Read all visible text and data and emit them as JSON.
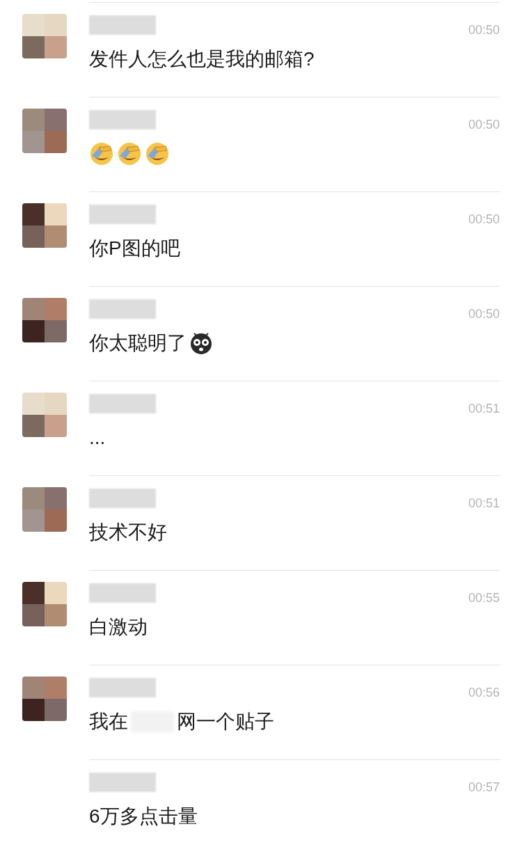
{
  "messages": [
    {
      "avatar": true,
      "time": "00:50",
      "parts": [
        {
          "kind": "text",
          "text": "发件人怎么也是我的邮箱?"
        }
      ]
    },
    {
      "avatar": true,
      "time": "00:50",
      "parts": [
        {
          "kind": "facepalm"
        },
        {
          "kind": "facepalm"
        },
        {
          "kind": "facepalm"
        }
      ]
    },
    {
      "avatar": true,
      "time": "00:50",
      "parts": [
        {
          "kind": "text",
          "text": "你P图的吧"
        }
      ]
    },
    {
      "avatar": true,
      "time": "00:50",
      "parts": [
        {
          "kind": "text",
          "text": "你太聪明了"
        },
        {
          "kind": "shocked"
        }
      ]
    },
    {
      "avatar": true,
      "time": "00:51",
      "parts": [
        {
          "kind": "text",
          "text": "..."
        }
      ]
    },
    {
      "avatar": true,
      "time": "00:51",
      "parts": [
        {
          "kind": "text",
          "text": "技术不好"
        }
      ]
    },
    {
      "avatar": true,
      "time": "00:55",
      "parts": [
        {
          "kind": "text",
          "text": "白激动"
        }
      ]
    },
    {
      "avatar": true,
      "time": "00:56",
      "parts": [
        {
          "kind": "text",
          "text": "我在"
        },
        {
          "kind": "redacted"
        },
        {
          "kind": "text",
          "text": "网一个贴子"
        }
      ]
    },
    {
      "avatar": false,
      "time": "00:57",
      "parts": [
        {
          "kind": "text",
          "text": "6万多点击量"
        }
      ]
    }
  ]
}
